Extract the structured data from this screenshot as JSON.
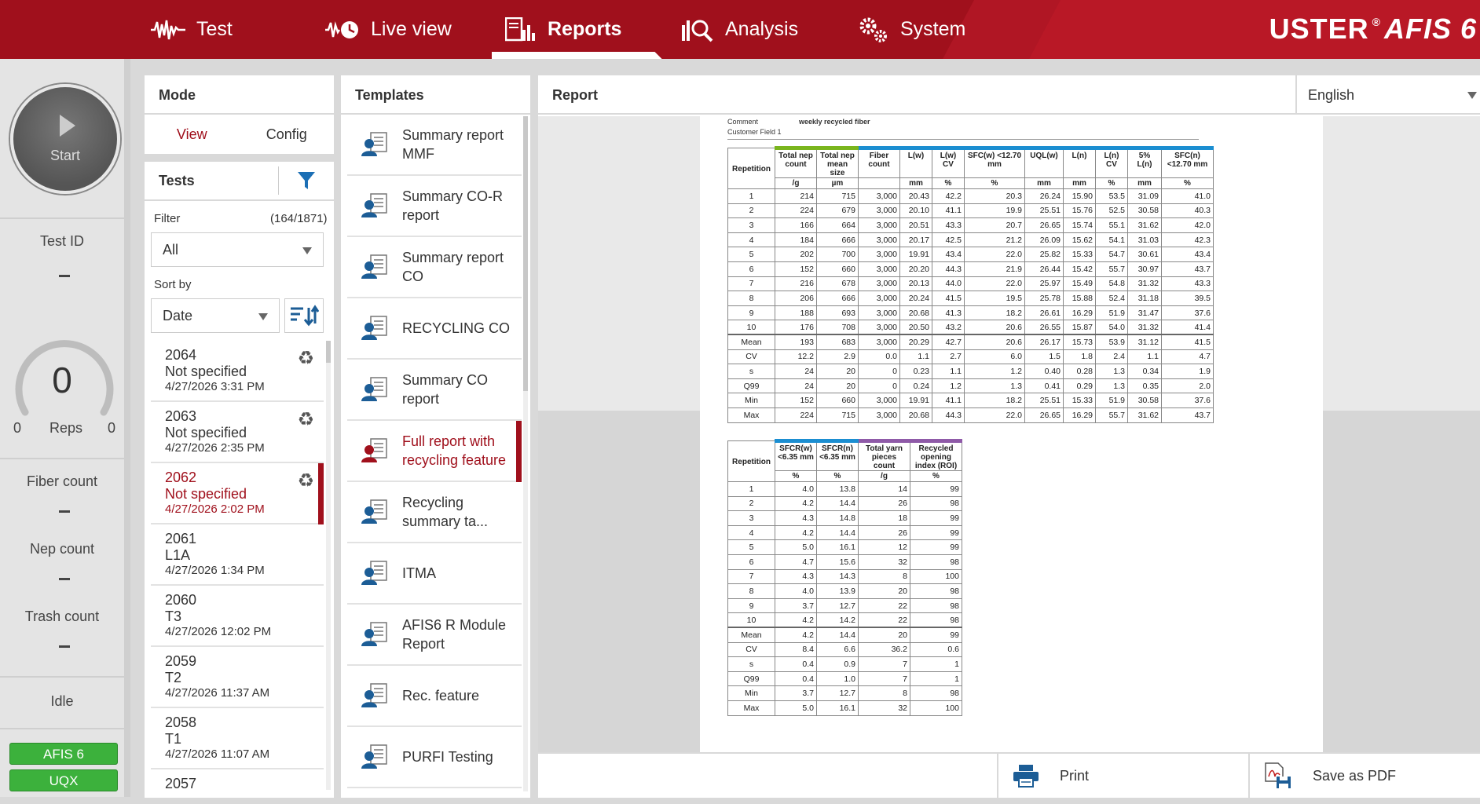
{
  "nav": {
    "items": [
      {
        "label": "Test",
        "icon": "test-waveform-icon"
      },
      {
        "label": "Live view",
        "icon": "live-view-icon"
      },
      {
        "label": "Reports",
        "icon": "reports-icon"
      },
      {
        "label": "Analysis",
        "icon": "analysis-icon"
      },
      {
        "label": "System",
        "icon": "gears-icon"
      }
    ],
    "active": "Reports",
    "brand_left": "USTER",
    "brand_reg": "®",
    "brand_right": "AFIS 6"
  },
  "status": {
    "start_label": "Start",
    "test_id_label": "Test ID",
    "reps_value": "0",
    "reps_min": "0",
    "reps_max": "0",
    "reps_label": "Reps",
    "fiber_count_label": "Fiber count",
    "nep_count_label": "Nep count",
    "trash_count_label": "Trash count",
    "state": "Idle",
    "modules": [
      "AFIS 6",
      "UQX"
    ]
  },
  "mode": {
    "title": "Mode",
    "tabs": [
      "View",
      "Config"
    ],
    "active": "View"
  },
  "tests": {
    "title": "Tests",
    "filter_label": "Filter",
    "filter_count": "(164/1871)",
    "filter_value": "All",
    "sort_label": "Sort by",
    "sort_value": "Date",
    "items": [
      {
        "id": "2064",
        "name": "Not specified",
        "date": "4/27/2026 3:31 PM",
        "recycled": true,
        "selected": false
      },
      {
        "id": "2063",
        "name": "Not specified",
        "date": "4/27/2026 2:35 PM",
        "recycled": true,
        "selected": false
      },
      {
        "id": "2062",
        "name": "Not specified",
        "date": "4/27/2026 2:02 PM",
        "recycled": true,
        "selected": true
      },
      {
        "id": "2061",
        "name": "L1A",
        "date": "4/27/2026 1:34 PM",
        "recycled": false,
        "selected": false
      },
      {
        "id": "2060",
        "name": "T3",
        "date": "4/27/2026 12:02 PM",
        "recycled": false,
        "selected": false
      },
      {
        "id": "2059",
        "name": "T2",
        "date": "4/27/2026 11:37 AM",
        "recycled": false,
        "selected": false
      },
      {
        "id": "2058",
        "name": "T1",
        "date": "4/27/2026 11:07 AM",
        "recycled": false,
        "selected": false
      },
      {
        "id": "2057",
        "name": "",
        "date": "",
        "recycled": false,
        "selected": false
      }
    ]
  },
  "templates": {
    "title": "Templates",
    "items": [
      {
        "label": "Summary report MMF",
        "selected": false
      },
      {
        "label": "Summary CO-R report",
        "selected": false
      },
      {
        "label": "Summary report CO",
        "selected": false
      },
      {
        "label": "RECYCLING CO",
        "selected": false
      },
      {
        "label": "Summary CO report",
        "selected": false
      },
      {
        "label": "Full report with recycling feature",
        "selected": true
      },
      {
        "label": "Recycling summary ta...",
        "selected": false
      },
      {
        "label": "ITMA",
        "selected": false
      },
      {
        "label": "AFIS6 R Module Report",
        "selected": false
      },
      {
        "label": "Rec. feature",
        "selected": false
      },
      {
        "label": "PURFI Testing",
        "selected": false
      }
    ]
  },
  "report": {
    "title": "Report",
    "language": "English",
    "print_label": "Print",
    "pdf_label": "Save as PDF",
    "meta": {
      "comment_label": "Comment",
      "comment_value": "weekly recycled fiber",
      "custom_label": "Customer Field 1"
    },
    "table1": {
      "rep_header": "Repetition",
      "columns": [
        {
          "h": "Total nep count",
          "u": "/g",
          "c": "green"
        },
        {
          "h": "Total nep mean size",
          "u": "µm",
          "c": "green"
        },
        {
          "h": "Fiber count",
          "u": "",
          "c": "blue"
        },
        {
          "h": "L(w)",
          "u": "mm",
          "c": "blue"
        },
        {
          "h": "L(w) CV",
          "u": "%",
          "c": "blue"
        },
        {
          "h": "SFC(w) <12.70 mm",
          "u": "%",
          "c": "blue"
        },
        {
          "h": "UQL(w)",
          "u": "mm",
          "c": "blue"
        },
        {
          "h": "L(n)",
          "u": "mm",
          "c": "blue"
        },
        {
          "h": "L(n) CV",
          "u": "%",
          "c": "blue"
        },
        {
          "h": "5% L(n)",
          "u": "mm",
          "c": "blue"
        },
        {
          "h": "SFC(n) <12.70 mm",
          "u": "%",
          "c": "blue"
        }
      ],
      "rows": [
        [
          "1",
          "214",
          "715",
          "3,000",
          "20.43",
          "42.2",
          "20.3",
          "26.24",
          "15.90",
          "53.5",
          "31.09",
          "41.0"
        ],
        [
          "2",
          "224",
          "679",
          "3,000",
          "20.10",
          "41.1",
          "19.9",
          "25.51",
          "15.76",
          "52.5",
          "30.58",
          "40.3"
        ],
        [
          "3",
          "166",
          "664",
          "3,000",
          "20.51",
          "43.3",
          "20.7",
          "26.65",
          "15.74",
          "55.1",
          "31.62",
          "42.0"
        ],
        [
          "4",
          "184",
          "666",
          "3,000",
          "20.17",
          "42.5",
          "21.2",
          "26.09",
          "15.62",
          "54.1",
          "31.03",
          "42.3"
        ],
        [
          "5",
          "202",
          "700",
          "3,000",
          "19.91",
          "43.4",
          "22.0",
          "25.82",
          "15.33",
          "54.7",
          "30.61",
          "43.4"
        ],
        [
          "6",
          "152",
          "660",
          "3,000",
          "20.20",
          "44.3",
          "21.9",
          "26.44",
          "15.42",
          "55.7",
          "30.97",
          "43.7"
        ],
        [
          "7",
          "216",
          "678",
          "3,000",
          "20.13",
          "44.0",
          "22.0",
          "25.97",
          "15.49",
          "54.8",
          "31.32",
          "43.3"
        ],
        [
          "8",
          "206",
          "666",
          "3,000",
          "20.24",
          "41.5",
          "19.5",
          "25.78",
          "15.88",
          "52.4",
          "31.18",
          "39.5"
        ],
        [
          "9",
          "188",
          "693",
          "3,000",
          "20.68",
          "41.3",
          "18.2",
          "26.61",
          "16.29",
          "51.9",
          "31.47",
          "37.6"
        ],
        [
          "10",
          "176",
          "708",
          "3,000",
          "20.50",
          "43.2",
          "20.6",
          "26.55",
          "15.87",
          "54.0",
          "31.32",
          "41.4"
        ]
      ],
      "stats": [
        [
          "Mean",
          "193",
          "683",
          "3,000",
          "20.29",
          "42.7",
          "20.6",
          "26.17",
          "15.73",
          "53.9",
          "31.12",
          "41.5"
        ],
        [
          "CV",
          "12.2",
          "2.9",
          "0.0",
          "1.1",
          "2.7",
          "6.0",
          "1.5",
          "1.8",
          "2.4",
          "1.1",
          "4.7"
        ],
        [
          "s",
          "24",
          "20",
          "0",
          "0.23",
          "1.1",
          "1.2",
          "0.40",
          "0.28",
          "1.3",
          "0.34",
          "1.9"
        ],
        [
          "Q99",
          "24",
          "20",
          "0",
          "0.24",
          "1.2",
          "1.3",
          "0.41",
          "0.29",
          "1.3",
          "0.35",
          "2.0"
        ],
        [
          "Min",
          "152",
          "660",
          "3,000",
          "19.91",
          "41.1",
          "18.2",
          "25.51",
          "15.33",
          "51.9",
          "30.58",
          "37.6"
        ],
        [
          "Max",
          "224",
          "715",
          "3,000",
          "20.68",
          "44.3",
          "22.0",
          "26.65",
          "16.29",
          "55.7",
          "31.62",
          "43.7"
        ]
      ]
    },
    "table2": {
      "rep_header": "Repetition",
      "columns": [
        {
          "h": "SFCR(w) <6.35 mm",
          "u": "%",
          "c": "blue"
        },
        {
          "h": "SFCR(n) <6.35 mm",
          "u": "%",
          "c": "blue"
        },
        {
          "h": "Total yarn pieces count",
          "u": "/g",
          "c": "purple"
        },
        {
          "h": "Recycled opening index (ROI)",
          "u": "%",
          "c": "purple"
        }
      ],
      "rows": [
        [
          "1",
          "4.0",
          "13.8",
          "14",
          "99"
        ],
        [
          "2",
          "4.2",
          "14.4",
          "26",
          "98"
        ],
        [
          "3",
          "4.3",
          "14.8",
          "18",
          "99"
        ],
        [
          "4",
          "4.2",
          "14.4",
          "26",
          "99"
        ],
        [
          "5",
          "5.0",
          "16.1",
          "12",
          "99"
        ],
        [
          "6",
          "4.7",
          "15.6",
          "32",
          "98"
        ],
        [
          "7",
          "4.3",
          "14.3",
          "8",
          "100"
        ],
        [
          "8",
          "4.0",
          "13.9",
          "20",
          "98"
        ],
        [
          "9",
          "3.7",
          "12.7",
          "22",
          "98"
        ],
        [
          "10",
          "4.2",
          "14.2",
          "22",
          "98"
        ]
      ],
      "stats": [
        [
          "Mean",
          "4.2",
          "14.4",
          "20",
          "99"
        ],
        [
          "CV",
          "8.4",
          "6.6",
          "36.2",
          "0.6"
        ],
        [
          "s",
          "0.4",
          "0.9",
          "7",
          "1"
        ],
        [
          "Q99",
          "0.4",
          "1.0",
          "7",
          "1"
        ],
        [
          "Min",
          "3.7",
          "12.7",
          "8",
          "98"
        ],
        [
          "Max",
          "5.0",
          "16.1",
          "32",
          "100"
        ]
      ]
    }
  },
  "colors": {
    "brand_red": "#a0101c",
    "module_green": "#3cb13c",
    "bar_green": "#7ab51d",
    "bar_blue": "#1b8ed1",
    "bar_purple": "#8f5aa8",
    "icon_blue": "#1c5d96"
  }
}
